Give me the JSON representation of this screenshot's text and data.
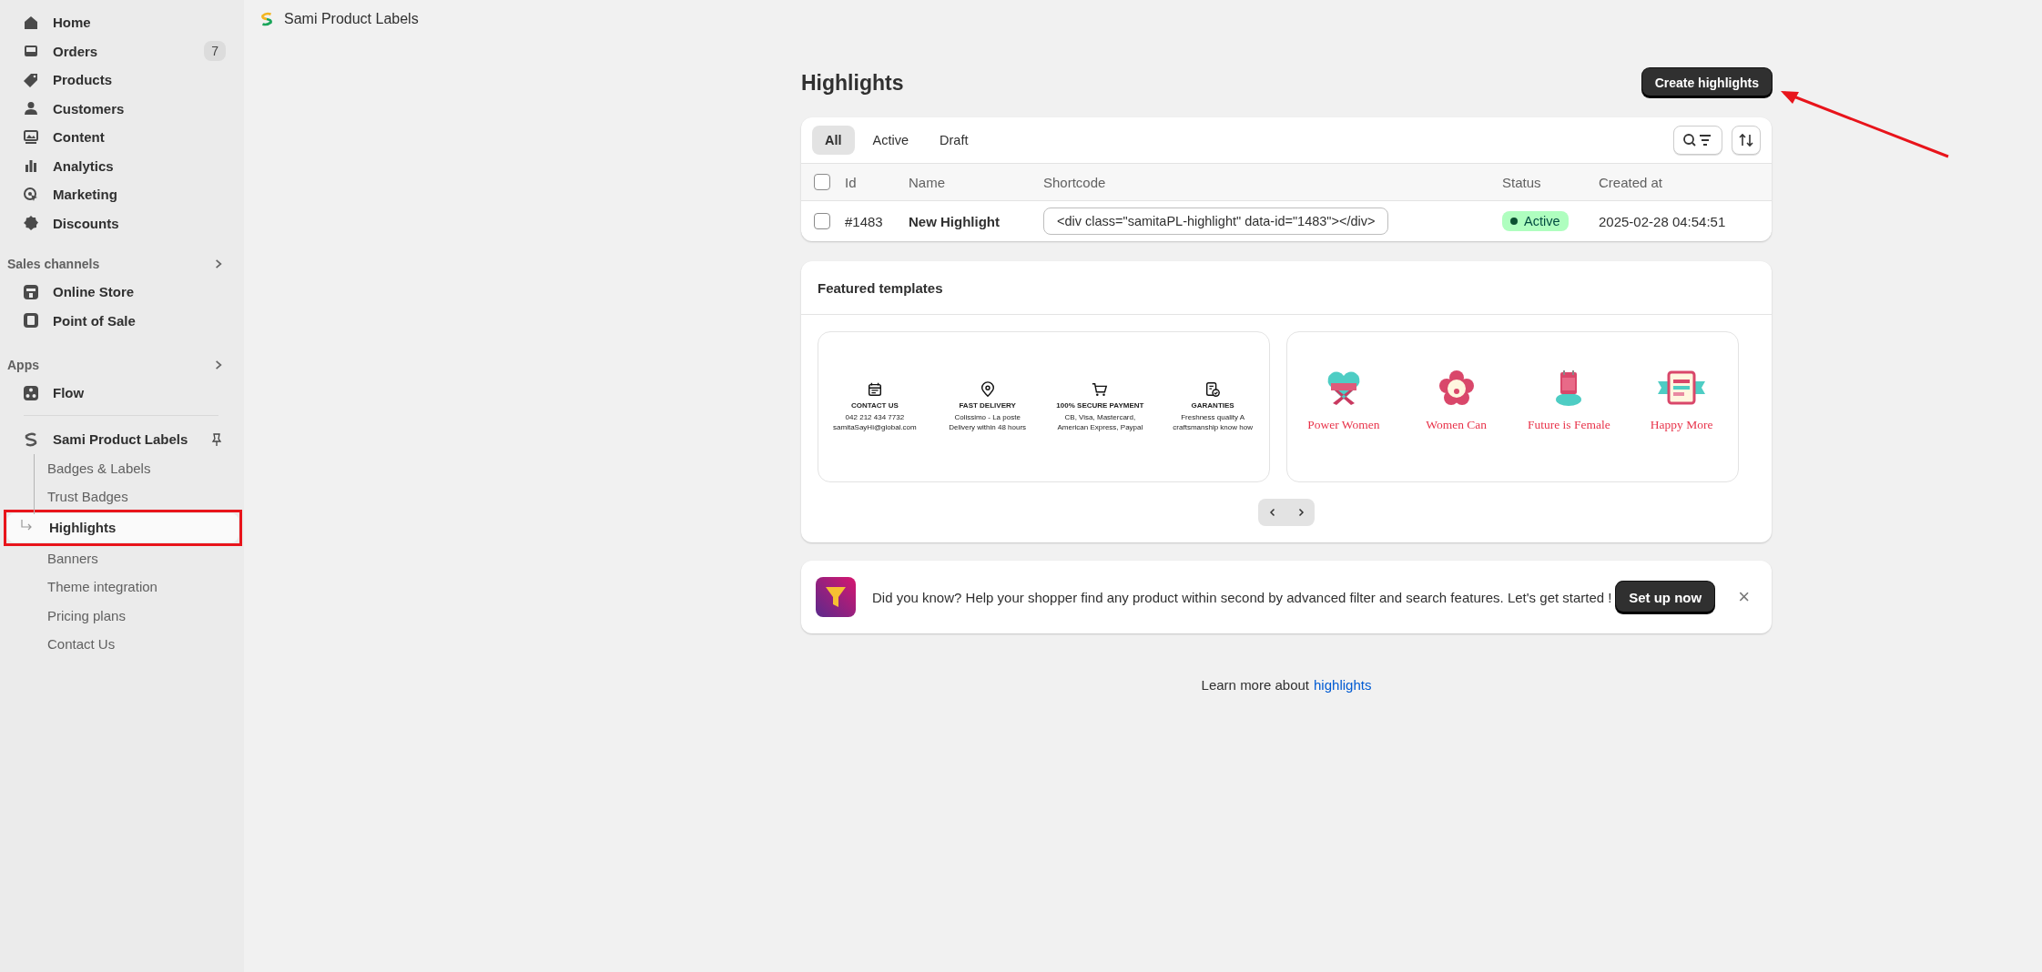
{
  "app_bar": {
    "title": "Sami Product Labels"
  },
  "sidebar": {
    "nav": [
      {
        "label": "Home"
      },
      {
        "label": "Orders",
        "badge": "7"
      },
      {
        "label": "Products"
      },
      {
        "label": "Customers"
      },
      {
        "label": "Content"
      },
      {
        "label": "Analytics"
      },
      {
        "label": "Marketing"
      },
      {
        "label": "Discounts"
      }
    ],
    "sections": [
      {
        "title": "Sales channels",
        "items": [
          {
            "label": "Online Store"
          },
          {
            "label": "Point of Sale"
          }
        ]
      },
      {
        "title": "Apps",
        "items": [
          {
            "label": "Flow"
          }
        ]
      }
    ],
    "app": {
      "name": "Sami Product Labels",
      "items": [
        {
          "label": "Badges & Labels",
          "selected": false
        },
        {
          "label": "Trust Badges",
          "selected": false
        },
        {
          "label": "Highlights",
          "selected": true
        },
        {
          "label": "Banners",
          "selected": false
        },
        {
          "label": "Theme integration",
          "selected": false
        },
        {
          "label": "Pricing plans",
          "selected": false
        },
        {
          "label": "Contact Us",
          "selected": false
        }
      ]
    }
  },
  "page": {
    "title": "Highlights",
    "primary_action": "Create highlights"
  },
  "table": {
    "tabs": [
      {
        "label": "All",
        "selected": true
      },
      {
        "label": "Active",
        "selected": false
      },
      {
        "label": "Draft",
        "selected": false
      }
    ],
    "select_all": {
      "checked": false
    },
    "columns": [
      "Id",
      "Name",
      "Shortcode",
      "Status",
      "Created at"
    ],
    "rows": [
      {
        "checked": false,
        "id": "#1483",
        "name": "New Highlight",
        "shortcode": "<div class=\"samitaPL-highlight\" data-id=\"1483\"></div>",
        "status": "Active",
        "created_at": "2025-02-28 04:54:51"
      }
    ]
  },
  "templates": {
    "title": "Featured templates",
    "cards": [
      {
        "kind": "features",
        "items": [
          {
            "title": "CONTACT US",
            "lines": [
              "042 212 434 7732",
              "samitaSayHi@global.com"
            ]
          },
          {
            "title": "FAST DELIVERY",
            "lines": [
              "Colissimo - La poste",
              "Delivery within 48 hours"
            ]
          },
          {
            "title": "100% SECURE PAYMENT",
            "lines": [
              "CB, Visa, Mastercard,",
              "American Express, Paypal"
            ]
          },
          {
            "title": "GARANTIES",
            "lines": [
              "Freshness quality A",
              "craftsmanship know how"
            ]
          }
        ]
      },
      {
        "kind": "badges",
        "items": [
          {
            "caption": "Power Women"
          },
          {
            "caption": "Women Can"
          },
          {
            "caption": "Future is Female"
          },
          {
            "caption": "Happy More"
          }
        ]
      }
    ]
  },
  "banner": {
    "text": "Did you know? Help your shopper find any product within second by advanced filter and search features. Let's get started !",
    "button": "Set up now",
    "close": "×"
  },
  "footer": {
    "text": "Learn more about",
    "link": "highlights"
  }
}
